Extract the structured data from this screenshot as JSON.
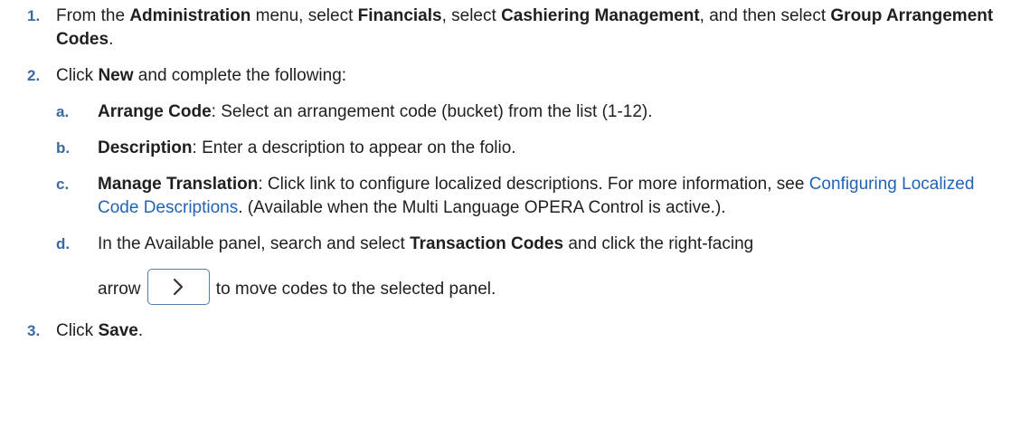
{
  "steps": {
    "s1": {
      "num": "1.",
      "t1": "From the ",
      "b1": "Administration",
      "t2": " menu, select ",
      "b2": "Financials",
      "t3": ", select ",
      "b3": "Cashiering Management",
      "t4": ", and then select ",
      "b4": "Group Arrangement Codes",
      "t5": "."
    },
    "s2": {
      "num": "2.",
      "t1": "Click ",
      "b1": "New",
      "t2": " and complete the following:",
      "a": {
        "num": "a.",
        "b1": "Arrange Code",
        "t1": ": Select an arrangement code (bucket) from the list (1-12)."
      },
      "b": {
        "num": "b.",
        "b1": "Description",
        "t1": ": Enter a description to appear on the folio."
      },
      "c": {
        "num": "c.",
        "b1": "Manage Translation",
        "t1": ": Click link to configure localized descriptions. For more information, see ",
        "link": "Configuring Localized Code Descriptions",
        "t2": ". (Available when the Multi Language OPERA Control is active.)."
      },
      "d": {
        "num": "d.",
        "t1": "In the Available panel, search and select ",
        "b1": "Transaction Codes",
        "t2": " and click the right-facing",
        "t3": "arrow",
        "t4": " to move codes to the selected panel."
      }
    },
    "s3": {
      "num": "3.",
      "t1": "Click ",
      "b1": "Save",
      "t2": "."
    }
  },
  "icons": {
    "move_right": "chevron-right-icon"
  },
  "colors": {
    "marker": "#3b6aa0",
    "link": "#2163b8",
    "button_border": "#4a7fb0"
  }
}
